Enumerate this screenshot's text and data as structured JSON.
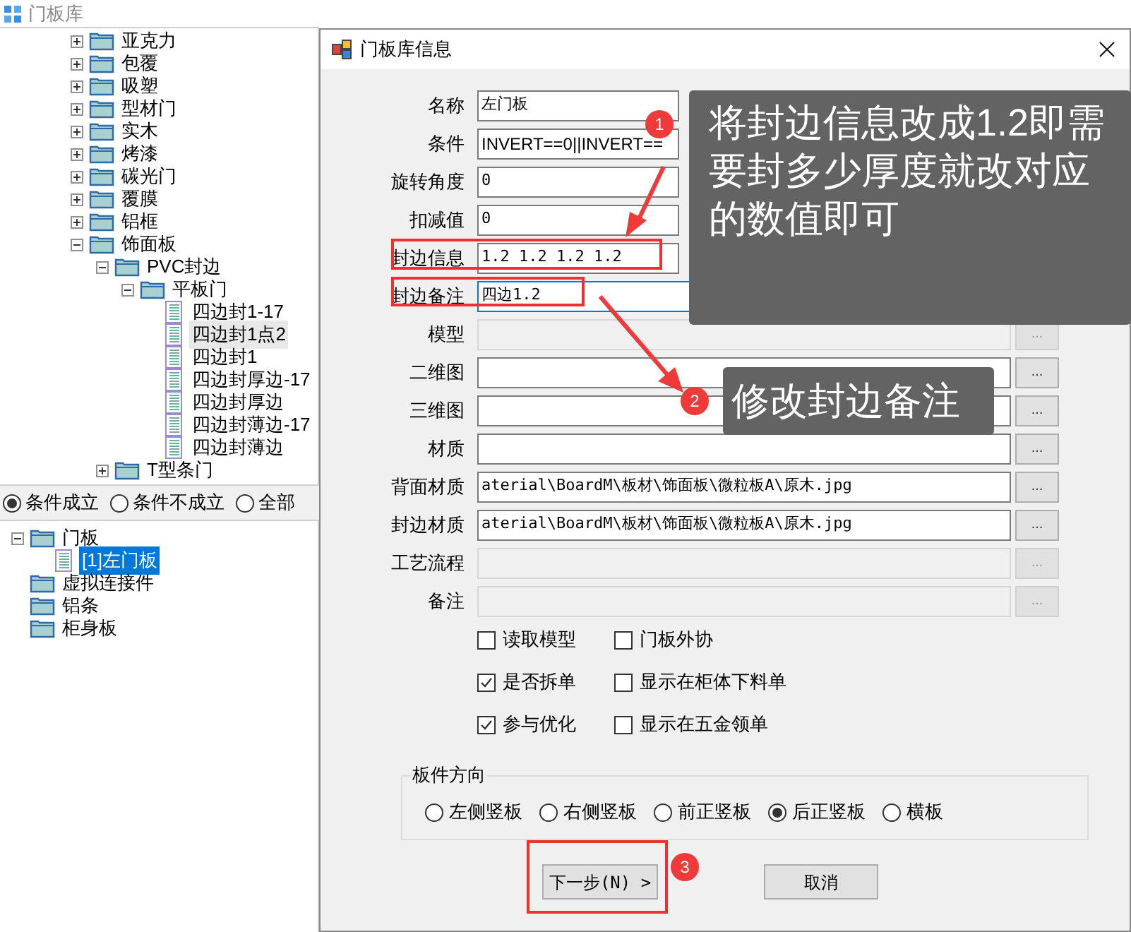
{
  "app_title": "门板库",
  "tree": [
    {
      "kind": "folder",
      "label": "亚克力",
      "expanded": false
    },
    {
      "kind": "folder",
      "label": "包覆",
      "expanded": false
    },
    {
      "kind": "folder",
      "label": "吸塑",
      "expanded": false
    },
    {
      "kind": "folder",
      "label": "型材门",
      "expanded": false
    },
    {
      "kind": "folder",
      "label": "实木",
      "expanded": false
    },
    {
      "kind": "folder",
      "label": "烤漆",
      "expanded": false
    },
    {
      "kind": "folder",
      "label": "碳光门",
      "expanded": false
    },
    {
      "kind": "folder",
      "label": "覆膜",
      "expanded": false
    },
    {
      "kind": "folder",
      "label": "铝框",
      "expanded": false
    },
    {
      "kind": "folder",
      "label": "饰面板",
      "expanded": true,
      "children": [
        {
          "kind": "folder",
          "label": "PVC封边",
          "expanded": true,
          "children": [
            {
              "kind": "folder",
              "label": "平板门",
              "expanded": true,
              "children": [
                {
                  "kind": "leaf",
                  "label": "四边封1-17",
                  "selected": false
                },
                {
                  "kind": "leaf",
                  "label": "四边封1点2",
                  "selected": true
                },
                {
                  "kind": "leaf",
                  "label": "四边封1",
                  "selected": false
                },
                {
                  "kind": "leaf",
                  "label": "四边封厚边-17",
                  "selected": false
                },
                {
                  "kind": "leaf",
                  "label": "四边封厚边",
                  "selected": false
                },
                {
                  "kind": "leaf",
                  "label": "四边封薄边-17",
                  "selected": false
                },
                {
                  "kind": "leaf",
                  "label": "四边封薄边",
                  "selected": false
                }
              ]
            }
          ]
        },
        {
          "kind": "folder",
          "label": "T型条门",
          "expanded": false
        }
      ]
    }
  ],
  "filter_radios": [
    {
      "label": "条件成立",
      "selected": true
    },
    {
      "label": "条件不成立",
      "selected": false
    },
    {
      "label": "全部",
      "selected": false
    }
  ],
  "result_tree": [
    {
      "kind": "folder",
      "label": "门板",
      "expanded": true,
      "children": [
        {
          "kind": "leaf",
          "label": "[1]左门板",
          "selected": true
        }
      ]
    },
    {
      "kind": "folder",
      "label": "虚拟连接件"
    },
    {
      "kind": "folder",
      "label": "铝条"
    },
    {
      "kind": "folder",
      "label": "柜身板"
    }
  ],
  "dialog": {
    "title": "门板库信息",
    "fields": [
      {
        "kind": "short",
        "label": "名称",
        "value": "左门板"
      },
      {
        "kind": "short",
        "label": "条件",
        "value": "INVERT==0||INVERT=="
      },
      {
        "kind": "short",
        "label": "旋转角度",
        "value": "0"
      },
      {
        "kind": "short",
        "label": "扣减值",
        "value": "0"
      },
      {
        "kind": "short",
        "label": "封边信息",
        "value": "1.2 1.2 1.2 1.2"
      },
      {
        "kind": "wide",
        "label": "封边备注",
        "value": "四边1.2",
        "focused": true
      },
      {
        "kind": "browse",
        "label": "模型",
        "disabled": true
      },
      {
        "kind": "browse",
        "label": "二维图",
        "disabled": false
      },
      {
        "kind": "browse",
        "label": "三维图",
        "disabled": false
      },
      {
        "kind": "browse",
        "label": "材质",
        "disabled": false
      },
      {
        "kind": "browse",
        "label": "背面材质",
        "value": "aterial\\BoardM\\板材\\饰面板\\微粒板A\\原木.jpg",
        "disabled": false
      },
      {
        "kind": "browse",
        "label": "封边材质",
        "value": "aterial\\BoardM\\板材\\饰面板\\微粒板A\\原木.jpg",
        "disabled": false
      },
      {
        "kind": "browse",
        "label": "工艺流程",
        "disabled": true
      },
      {
        "kind": "browse",
        "label": "备注",
        "disabled": true
      }
    ],
    "browse_button": "...",
    "checkboxes": [
      {
        "label": "读取模型",
        "checked": false
      },
      {
        "label": "门板外协",
        "checked": false
      },
      {
        "label": "是否拆单",
        "checked": true
      },
      {
        "label": "显示在柜体下料单",
        "checked": false
      },
      {
        "label": "参与优化",
        "checked": true
      },
      {
        "label": "显示在五金领单",
        "checked": false
      }
    ],
    "orientation": {
      "title": "板件方向",
      "options": [
        {
          "label": "左侧竖板",
          "selected": false
        },
        {
          "label": "右侧竖板",
          "selected": false
        },
        {
          "label": "前正竖板",
          "selected": false
        },
        {
          "label": "后正竖板",
          "selected": true
        },
        {
          "label": "横板",
          "selected": false
        }
      ]
    },
    "buttons": [
      {
        "label": "下一步(N) >"
      },
      {
        "label": "取消"
      }
    ]
  },
  "annotations": [
    {
      "number": "1",
      "text": "将封边信息改成1.2即需要封多少厚度就改对应的数值即可"
    },
    {
      "number": "2",
      "text": "修改封边备注"
    },
    {
      "number": "3"
    }
  ]
}
